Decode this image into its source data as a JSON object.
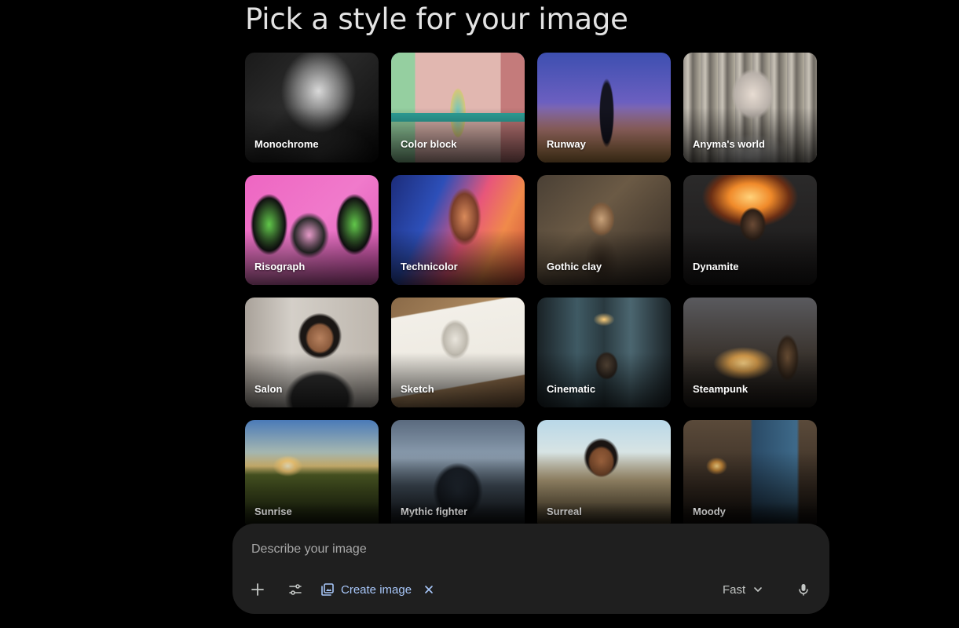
{
  "page": {
    "title": "Pick a style for your image"
  },
  "styles": [
    {
      "label": "Monochrome"
    },
    {
      "label": "Color block"
    },
    {
      "label": "Runway"
    },
    {
      "label": "Anyma's world"
    },
    {
      "label": "Risograph"
    },
    {
      "label": "Technicolor"
    },
    {
      "label": "Gothic clay"
    },
    {
      "label": "Dynamite"
    },
    {
      "label": "Salon"
    },
    {
      "label": "Sketch"
    },
    {
      "label": "Cinematic"
    },
    {
      "label": "Steampunk"
    },
    {
      "label": "Sunrise"
    },
    {
      "label": "Mythic fighter"
    },
    {
      "label": "Surreal"
    },
    {
      "label": "Moody"
    }
  ],
  "composer": {
    "placeholder": "Describe your image",
    "create_chip": "Create image",
    "model": "Fast",
    "icons": {
      "add": "plus-icon",
      "tools": "tune-icon",
      "chip": "image-gallery-icon",
      "chip_close": "close-icon",
      "model_dropdown": "chevron-down-icon",
      "mic": "microphone-icon"
    }
  },
  "colors": {
    "background": "#000000",
    "composer_bg": "#1f1f1f",
    "accent_blue": "#a8c7fa",
    "text_primary": "#e3e3e3"
  }
}
